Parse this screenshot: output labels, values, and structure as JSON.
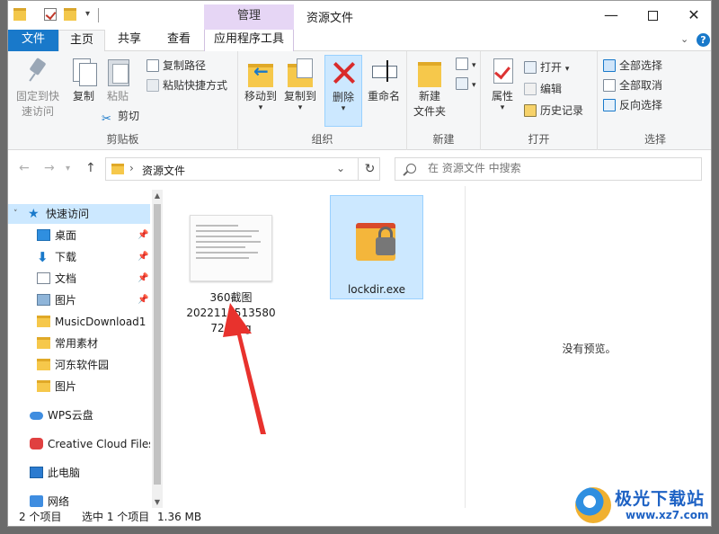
{
  "window": {
    "title": "资源文件",
    "manage_tab": "管理",
    "min_glyph": "—",
    "close_glyph": "✕"
  },
  "tabs": {
    "file": "文件",
    "home": "主页",
    "share": "共享",
    "view": "查看",
    "apptools": "应用程序工具",
    "chevron": "⌄",
    "help": "?"
  },
  "ribbon": {
    "clipboard": {
      "label": "剪贴板",
      "pin": "固定到快速访问",
      "pin_l1": "固定到快",
      "pin_l2": "速访问",
      "copy": "复制",
      "paste": "粘贴",
      "copy_path": "复制路径",
      "paste_shortcut": "粘贴快捷方式",
      "cut": "剪切"
    },
    "organize": {
      "label": "组织",
      "move_to": "移动到",
      "copy_to": "复制到",
      "delete": "删除",
      "rename": "重命名"
    },
    "new": {
      "label": "新建",
      "new_folder_l1": "新建",
      "new_folder_l2": "文件夹"
    },
    "open": {
      "label": "打开",
      "properties": "属性",
      "open": "打开",
      "edit": "编辑",
      "history": "历史记录"
    },
    "select": {
      "label": "选择",
      "select_all": "全部选择",
      "select_none": "全部取消",
      "invert": "反向选择"
    }
  },
  "address": {
    "path": "资源文件",
    "search_placeholder": "在 资源文件 中搜索"
  },
  "sidebar": {
    "items": [
      {
        "label": "快速访问"
      },
      {
        "label": "桌面"
      },
      {
        "label": "下载"
      },
      {
        "label": "文档"
      },
      {
        "label": "图片"
      },
      {
        "label": "MusicDownload1"
      },
      {
        "label": "常用素材"
      },
      {
        "label": "河东软件园"
      },
      {
        "label": "图片"
      },
      {
        "label": "WPS云盘"
      },
      {
        "label": "Creative Cloud Files"
      },
      {
        "label": "此电脑"
      },
      {
        "label": "网络"
      }
    ]
  },
  "files": [
    {
      "name_l1": "360截图",
      "name_l2": "2022111513580",
      "name_l3": "724.jpg"
    },
    {
      "name_l1": "lockdir.exe"
    }
  ],
  "preview": {
    "text": "没有预览。"
  },
  "status": {
    "count": "2 个项目",
    "selected": "选中 1 个项目",
    "size": "1.36 MB"
  },
  "watermark": {
    "title": "极光下载站",
    "url": "www.xz7.com"
  },
  "colors": {
    "accent": "#1979ca",
    "selection": "#cce8ff",
    "manage_tab": "#e6d6f5",
    "arrow": "#e8322d"
  }
}
